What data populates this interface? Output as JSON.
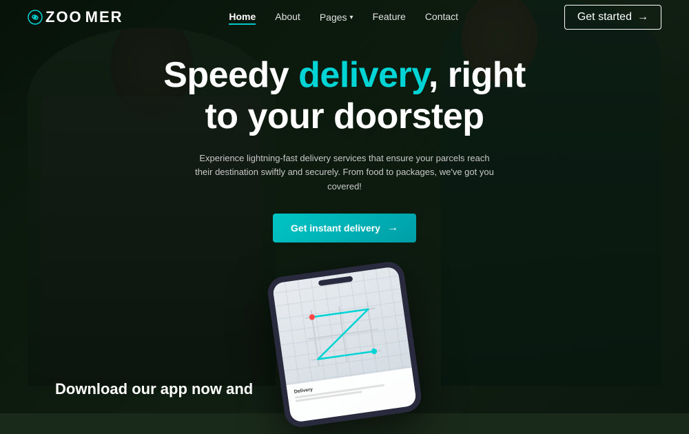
{
  "brand": {
    "name_part1": "ZOO",
    "name_part2": "MER",
    "logo_icon": "🌀"
  },
  "nav": {
    "links": [
      {
        "label": "Home",
        "active": true
      },
      {
        "label": "About",
        "active": false
      },
      {
        "label": "Pages",
        "active": false,
        "has_dropdown": true
      },
      {
        "label": "Feature",
        "active": false
      },
      {
        "label": "Contact",
        "active": false
      }
    ],
    "cta_button": "Get started",
    "cta_arrow": "→"
  },
  "hero": {
    "title_part1": "Speedy ",
    "title_highlight": "delivery",
    "title_part2": ", right",
    "title_line2": "to your doorstep",
    "description": "Experience lightning-fast delivery services that ensure your parcels reach their destination swiftly and securely. From food to packages, we've got you covered!",
    "cta_label": "Get instant delivery",
    "cta_arrow": "→"
  },
  "bottom": {
    "text_line1": "Download our app now and"
  },
  "colors": {
    "accent": "#00d4d4",
    "nav_border": "#00c8c8",
    "background": "#1a2a1a"
  }
}
